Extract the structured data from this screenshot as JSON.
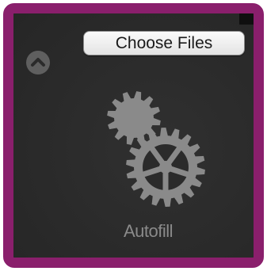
{
  "file_input": {
    "button_label": "Choose Files"
  },
  "widget": {
    "label": "Autofill",
    "icon": "gears-icon",
    "collapse_icon": "chevron-up-icon"
  },
  "colors": {
    "border": "#8a1f6c",
    "panel": "#2b2b2b",
    "gear": "#8a8a8a",
    "label": "#8a8a8a"
  }
}
